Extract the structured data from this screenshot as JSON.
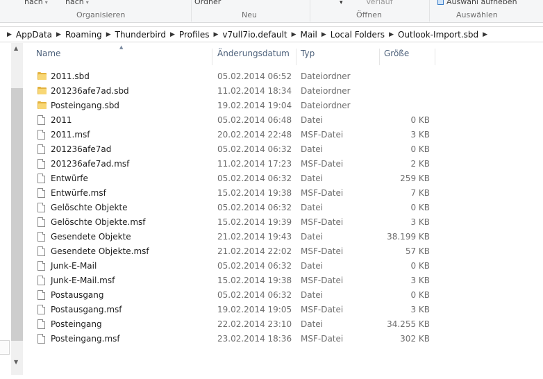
{
  "ribbon": {
    "items": [
      {
        "label": "nach",
        "dropdown": true
      },
      {
        "label": "nach",
        "dropdown": true
      },
      {
        "label": "Ordner",
        "dropdown": false
      },
      {
        "label": "",
        "dropdown": true
      },
      {
        "label": "Verlauf",
        "dropdown": false
      },
      {
        "label": "Auswahl aufheben",
        "dropdown": false
      }
    ],
    "groups": [
      "Organisieren",
      "Neu",
      "Öffnen",
      "Auswählen"
    ]
  },
  "breadcrumb": [
    "AppData",
    "Roaming",
    "Thunderbird",
    "Profiles",
    "v7ull7io.default",
    "Mail",
    "Local Folders",
    "Outlook-Import.sbd"
  ],
  "columns": {
    "name": "Name",
    "date": "Änderungsdatum",
    "type": "Typ",
    "size": "Größe"
  },
  "files": [
    {
      "name": "2011.sbd",
      "date": "05.02.2014 06:52",
      "type": "Dateiordner",
      "size": "",
      "icon": "folder-icon"
    },
    {
      "name": "201236afe7ad.sbd",
      "date": "11.02.2014 18:34",
      "type": "Dateiordner",
      "size": "",
      "icon": "folder-icon"
    },
    {
      "name": "Posteingang.sbd",
      "date": "19.02.2014 19:04",
      "type": "Dateiordner",
      "size": "",
      "icon": "folder-icon"
    },
    {
      "name": "2011",
      "date": "05.02.2014 06:48",
      "type": "Datei",
      "size": "0 KB",
      "icon": "file-icon"
    },
    {
      "name": "2011.msf",
      "date": "20.02.2014 22:48",
      "type": "MSF-Datei",
      "size": "3 KB",
      "icon": "file-icon"
    },
    {
      "name": "201236afe7ad",
      "date": "05.02.2014 06:32",
      "type": "Datei",
      "size": "0 KB",
      "icon": "file-icon"
    },
    {
      "name": "201236afe7ad.msf",
      "date": "11.02.2014 17:23",
      "type": "MSF-Datei",
      "size": "2 KB",
      "icon": "file-icon"
    },
    {
      "name": "Entwürfe",
      "date": "05.02.2014 06:32",
      "type": "Datei",
      "size": "259 KB",
      "icon": "file-icon"
    },
    {
      "name": "Entwürfe.msf",
      "date": "15.02.2014 19:38",
      "type": "MSF-Datei",
      "size": "7 KB",
      "icon": "file-icon"
    },
    {
      "name": "Gelöschte Objekte",
      "date": "05.02.2014 06:32",
      "type": "Datei",
      "size": "0 KB",
      "icon": "file-icon"
    },
    {
      "name": "Gelöschte Objekte.msf",
      "date": "15.02.2014 19:39",
      "type": "MSF-Datei",
      "size": "3 KB",
      "icon": "file-icon"
    },
    {
      "name": "Gesendete Objekte",
      "date": "21.02.2014 19:43",
      "type": "Datei",
      "size": "38.199 KB",
      "icon": "file-icon"
    },
    {
      "name": "Gesendete Objekte.msf",
      "date": "21.02.2014 22:02",
      "type": "MSF-Datei",
      "size": "57 KB",
      "icon": "file-icon"
    },
    {
      "name": "Junk-E-Mail",
      "date": "05.02.2014 06:32",
      "type": "Datei",
      "size": "0 KB",
      "icon": "file-icon"
    },
    {
      "name": "Junk-E-Mail.msf",
      "date": "15.02.2014 19:38",
      "type": "MSF-Datei",
      "size": "3 KB",
      "icon": "file-icon"
    },
    {
      "name": "Postausgang",
      "date": "05.02.2014 06:32",
      "type": "Datei",
      "size": "0 KB",
      "icon": "file-icon"
    },
    {
      "name": "Postausgang.msf",
      "date": "19.02.2014 19:05",
      "type": "MSF-Datei",
      "size": "3 KB",
      "icon": "file-icon"
    },
    {
      "name": "Posteingang",
      "date": "22.02.2014 23:10",
      "type": "Datei",
      "size": "34.255 KB",
      "icon": "file-icon"
    },
    {
      "name": "Posteingang.msf",
      "date": "23.02.2014 18:36",
      "type": "MSF-Datei",
      "size": "302 KB",
      "icon": "file-icon"
    }
  ]
}
